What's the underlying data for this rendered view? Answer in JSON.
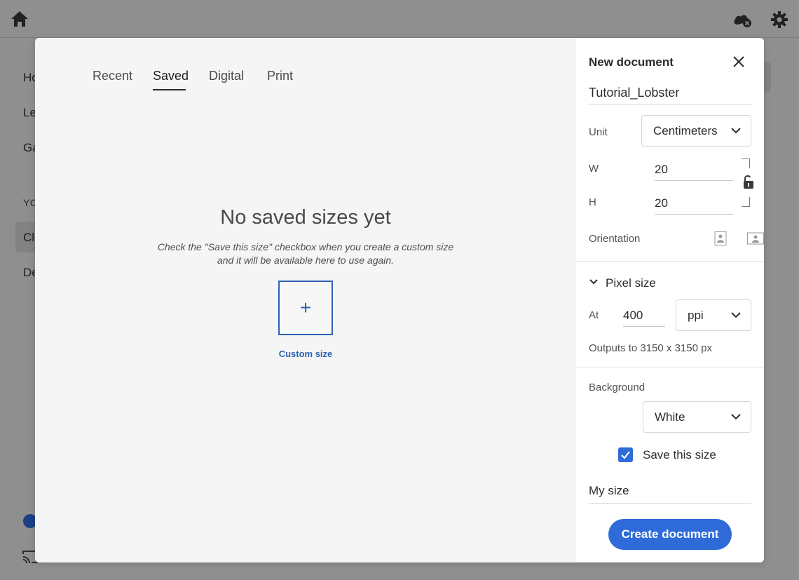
{
  "background_app": {
    "nav_items": [
      "Ho",
      "Le",
      "Ga"
    ],
    "section_label": "YC",
    "nav_items_2": [
      "Cl",
      "De"
    ]
  },
  "tabs": [
    {
      "label": "Recent"
    },
    {
      "label": "Saved"
    },
    {
      "label": "Digital"
    },
    {
      "label": "Print"
    }
  ],
  "active_tab": "Saved",
  "empty_state": {
    "title": "No saved sizes yet",
    "description_line1": "Check the \"Save this size\" checkbox when you create a custom size",
    "description_line2": "and it will be available here to use again.",
    "custom_size_symbol": "+",
    "custom_size_label": "Custom size"
  },
  "panel": {
    "title": "New document",
    "document_name": "Tutorial_Lobster",
    "unit_label": "Unit",
    "unit_value": "Centimeters",
    "width_label": "W",
    "width_value": "20",
    "height_label": "H",
    "height_value": "20",
    "orientation_label": "Orientation",
    "pixel_size_label": "Pixel size",
    "at_label": "At",
    "resolution_value": "400",
    "resolution_unit": "ppi",
    "outputs_text": "Outputs to 3150 x 3150 px",
    "background_label": "Background",
    "background_value": "White",
    "save_size_label": "Save this size",
    "save_size_checked": true,
    "size_name": "My size",
    "create_label": "Create document"
  },
  "colors": {
    "accent": "#2e6bd8",
    "custom_size_blue": "#2e62b4"
  },
  "icons": {
    "top_left": "home-icon",
    "top_right": [
      "cloud-offline-icon",
      "gear-icon"
    ],
    "close": "close-icon",
    "lock": "unlock-icon",
    "orientation": [
      "portrait-icon",
      "landscape-icon"
    ]
  }
}
